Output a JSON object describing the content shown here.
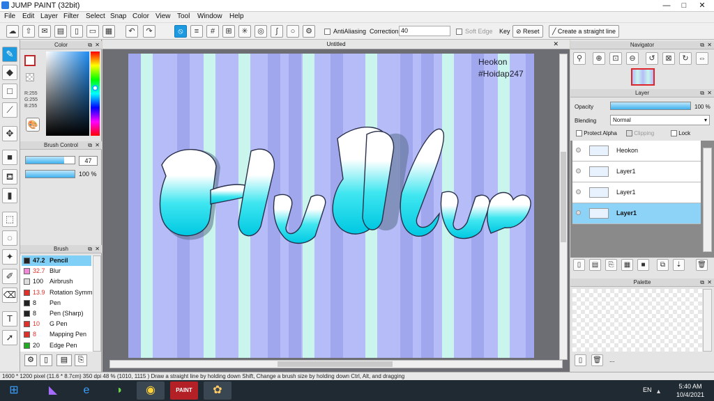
{
  "window": {
    "title": "JUMP PAINT (32bit)",
    "minimize": "—",
    "maximize": "□",
    "close": "✕"
  },
  "menu": [
    "File",
    "Edit",
    "Layer",
    "Filter",
    "Select",
    "Snap",
    "Color",
    "View",
    "Tool",
    "Window",
    "Help"
  ],
  "toolbar": {
    "antialias_label": "AntiAliasing",
    "correction_label": "Correction",
    "correction_value": "40",
    "soft_edge_label": "Soft Edge",
    "key_label": "Key",
    "reset_label": "Reset",
    "straight_line_label": "Create a straight line"
  },
  "color_panel": {
    "title": "Color",
    "r": "R:255",
    "g": "G:255",
    "b": "B:255",
    "primary": "#ffffff",
    "secondary": "#ffffff"
  },
  "brush_control": {
    "title": "Brush Control",
    "size": "47",
    "opacity": "100 %",
    "size_fraction": 0.78,
    "opacity_fraction": 1.0
  },
  "brush_panel": {
    "title": "Brush",
    "items": [
      {
        "size": "47.2",
        "name": "Pencil",
        "color": "#222222",
        "selected": true
      },
      {
        "size": "32.7",
        "name": "Blur",
        "color": "#f08ad8"
      },
      {
        "size": "100",
        "name": "Airbrush",
        "color": "#dddddd"
      },
      {
        "size": "13.9",
        "name": "Rotation Symm",
        "color": "#e0302a"
      },
      {
        "size": "8",
        "name": "Pen",
        "color": "#222222"
      },
      {
        "size": "8",
        "name": "Pen (Sharp)",
        "color": "#222222"
      },
      {
        "size": "10",
        "name": "G Pen",
        "color": "#e0302a"
      },
      {
        "size": "8",
        "name": "Mapping Pen",
        "color": "#e0302a"
      },
      {
        "size": "20",
        "name": "Edge Pen",
        "color": "#22aa22"
      }
    ]
  },
  "document": {
    "tab": "Untitled",
    "watermark_line1": "Heokon",
    "watermark_line2": "#Hoidap247",
    "lettering": "Huthu"
  },
  "navigator": {
    "title": "Navigator"
  },
  "layer_panel": {
    "title": "Layer",
    "opacity_label": "Opacity",
    "opacity_value": "100 %",
    "blending_label": "Blending",
    "blending_value": "Normal",
    "protect_alpha": "Protect Alpha",
    "clipping": "Clipping",
    "lock": "Lock",
    "layers": [
      {
        "name": "Heokon",
        "selected": false
      },
      {
        "name": "Layer1",
        "selected": false
      },
      {
        "name": "Layer1",
        "selected": false
      },
      {
        "name": "Layer1",
        "selected": true
      }
    ]
  },
  "palette": {
    "title": "Palette",
    "more": "..."
  },
  "status": "1600 * 1200 pixel  (11.6 * 8.7cm)  350 dpi  48 %   (1010, 1115 )   Draw a straight line by holding down Shift, Change a brush size by holding down Ctrl, Alt, and dragging",
  "taskbar": {
    "lang": "EN",
    "time": "5:40 AM",
    "date": "10/4/2021"
  },
  "colors": {
    "accent": "#1e9be0",
    "paper_bg": "#b5bcf8",
    "stripe_light": "#c9f5ec",
    "stripe_dark": "#8e96e2",
    "letter_top": "#ffffff",
    "letter_bottom": "#00d8ea"
  }
}
